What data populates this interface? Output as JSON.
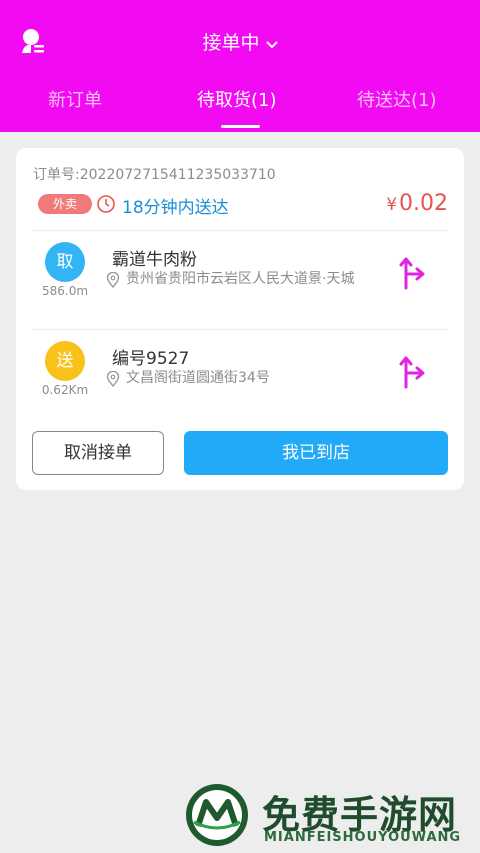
{
  "colors": {
    "header_bg": "#f20af2",
    "pickup_circle": "#33b5f5",
    "deliver_circle": "#f9c21a",
    "badge_bg": "#f07a7a",
    "primary_button": "#21aaf8",
    "nav_arrow": "#e025e0"
  },
  "header": {
    "title": "接单中",
    "tabs": [
      {
        "label": "新订单"
      },
      {
        "label": "待取货(1)"
      },
      {
        "label": "待送达(1)"
      }
    ],
    "active_tab": "待取货(1)"
  },
  "order": {
    "number_label": "订单号:",
    "number": "2022072715411235033710",
    "type_badge": "外卖",
    "eta": "18分钟内送达",
    "currency": "¥",
    "price": "0.02",
    "pickup": {
      "circle_label": "取",
      "distance": "586.0m",
      "name": "霸道牛肉粉",
      "address": "贵州省贵阳市云岩区人民大道景·天城"
    },
    "delivery": {
      "circle_label": "送",
      "distance": "0.62Km",
      "name": "编号9527",
      "address": "文昌阁街道圆通街34号"
    },
    "buttons": {
      "cancel": "取消接单",
      "arrived": "我已到店"
    }
  },
  "watermark": {
    "title": "免费手游网",
    "subtitle": "MIANFEISHOUYOUWANG"
  }
}
